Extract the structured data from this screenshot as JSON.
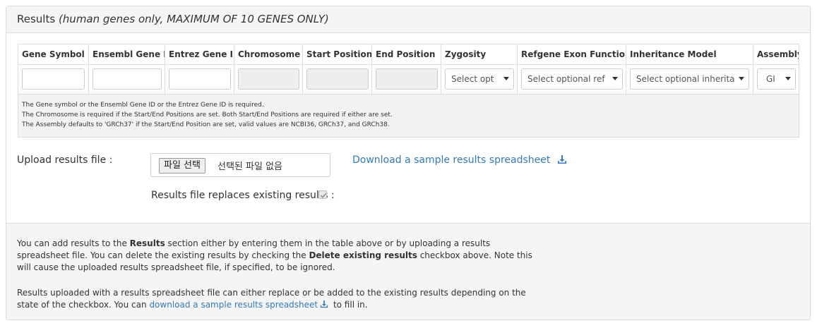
{
  "panel": {
    "title": "Results",
    "subtitle": "(human genes only, MAXIMUM OF 10 GENES ONLY)"
  },
  "table": {
    "columns": [
      "Gene Symbol",
      "Ensembl Gene ID",
      "Entrez Gene ID",
      "Chromosome",
      "Start Position",
      "End Position",
      "Zygosity",
      "Refgene Exon Function",
      "Inheritance Model",
      "Assembly"
    ],
    "inputs": {
      "gene_symbol": "",
      "ensembl_gene_id": "",
      "entrez_gene_id": "",
      "chromosome": "",
      "start_position": "",
      "end_position": ""
    },
    "selects": {
      "zygosity": "Select opt",
      "refgene_exon_function": "Select optional ref",
      "inheritance_model": "Select optional inherita",
      "assembly": "GI"
    },
    "notes": [
      "The Gene symbol or the Ensembl Gene ID or the Entrez Gene ID is required.",
      "The Chromosome is required if the Start/End Positions are set. Both Start/End Positions are required if either are set.",
      "The Assembly defaults to 'GRCh37' if the Start/End Position are set, valid values are NCBI36, GRCh37, and GRCh38."
    ]
  },
  "upload": {
    "label": "Upload results file :",
    "file_button": "파일 선택",
    "file_status": "선택된 파일 없음",
    "download_link": "Download a sample results spreadsheet",
    "replace_label": "Results file replaces existing results :",
    "replace_checked": true
  },
  "footer": {
    "p1_a": "You can add results to the ",
    "p1_b": "Results",
    "p1_c": " section either by entering them in the table above or by uploading a results spreadsheet file. You can delete the existing results by checking the ",
    "p1_d": "Delete existing results",
    "p1_e": " checkbox above. Note this will cause the uploaded results spreadsheet file, if specified, to be ignored.",
    "p2_a": "Results uploaded with a results spreadsheet file can either replace or be added to the existing results depending on the state of the checkbox. You can ",
    "p2_link": "download a sample results spreadsheet",
    "p2_b": " to fill in."
  },
  "colors": {
    "link": "#337ab7",
    "heading_bg": "#f5f5f5",
    "border": "#dddddd"
  }
}
